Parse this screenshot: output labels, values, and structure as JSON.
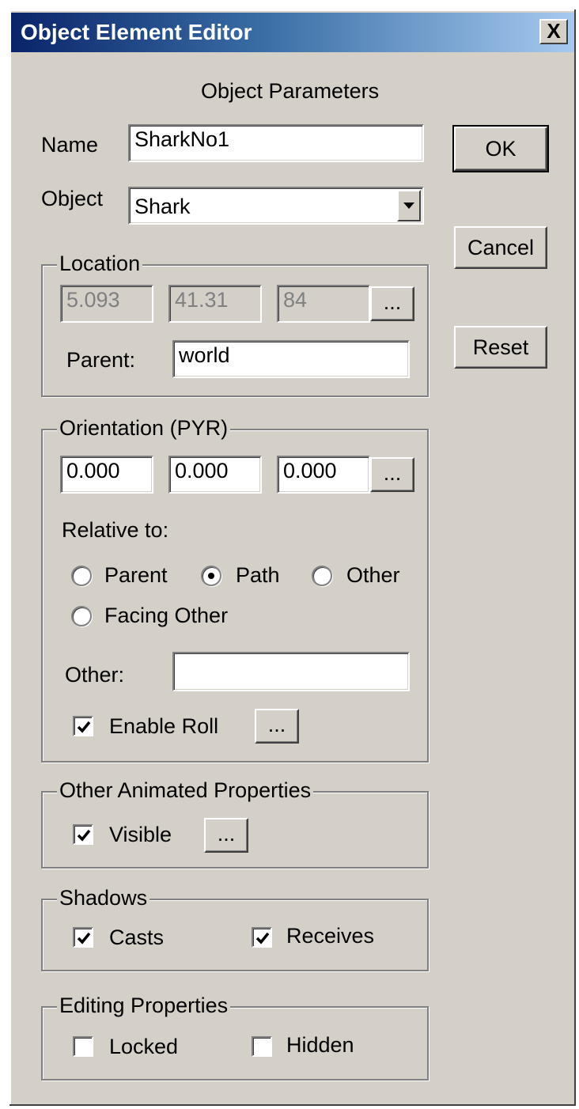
{
  "window": {
    "title": "Object Element Editor",
    "close_glyph": "X"
  },
  "header": {
    "title": "Object Parameters"
  },
  "name": {
    "label": "Name",
    "value": "SharkNo1"
  },
  "object": {
    "label": "Object",
    "value": "Shark"
  },
  "buttons": {
    "ok": "OK",
    "cancel": "Cancel",
    "reset": "Reset"
  },
  "location": {
    "group_label": "Location",
    "x": "5.093",
    "y": "41.31",
    "z": "84",
    "more": "...",
    "parent_label": "Parent:",
    "parent_value": "world"
  },
  "orientation": {
    "group_label": "Orientation (PYR)",
    "p": "0.000",
    "y": "0.000",
    "r": "0.000",
    "more": "...",
    "relative_label": "Relative to:",
    "options": [
      "Parent",
      "Path",
      "Other",
      "Facing Other"
    ],
    "selected": "Path",
    "other_label": "Other:",
    "other_value": "",
    "enable_roll_label": "Enable Roll",
    "enable_roll_checked": true,
    "roll_more": "..."
  },
  "animated": {
    "group_label": "Other Animated Properties",
    "visible_label": "Visible",
    "visible_checked": true,
    "more": "..."
  },
  "shadows": {
    "group_label": "Shadows",
    "casts_label": "Casts",
    "casts_checked": true,
    "receives_label": "Receives",
    "receives_checked": true
  },
  "editing": {
    "group_label": "Editing Properties",
    "locked_label": "Locked",
    "locked_checked": false,
    "hidden_label": "Hidden",
    "hidden_checked": false
  },
  "colors": {
    "face": "#d4d0c8",
    "title_start": "#0a246a",
    "title_end": "#a6caf0"
  }
}
